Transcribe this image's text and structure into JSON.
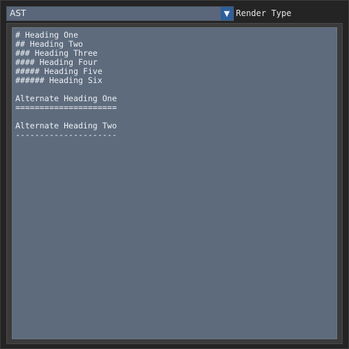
{
  "toolbar": {
    "render_type_value": "AST",
    "dropdown_icon": "triangle-down-icon",
    "render_type_label": "Render Type"
  },
  "editor": {
    "lines": [
      "# Heading One",
      "## Heading Two",
      "### Heading Three",
      "#### Heading Four",
      "##### Heading Five",
      "###### Heading Six",
      "",
      "Alternate Heading One",
      "=====================",
      "",
      "Alternate Heading Two",
      "---------------------"
    ]
  },
  "colors": {
    "background": "#242424",
    "combo": "#5a677a",
    "combo_arrow": "#2f5f9a",
    "editor": "#5d6b7d",
    "text": "#eef1f5"
  }
}
